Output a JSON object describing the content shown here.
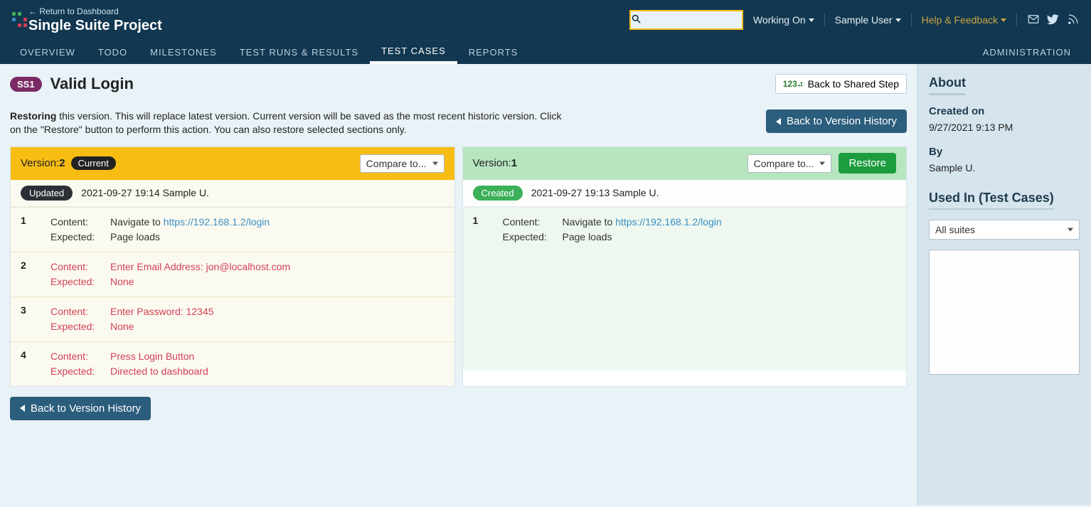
{
  "header": {
    "return_link": "← Return to Dashboard",
    "project": "Single Suite Project",
    "working_on": "Working On",
    "user": "Sample User",
    "help": "Help & Feedback"
  },
  "tabs": {
    "overview": "OVERVIEW",
    "todo": "TODO",
    "milestones": "MILESTONES",
    "testruns": "TEST RUNS & RESULTS",
    "testcases": "TEST CASES",
    "reports": "REPORTS",
    "admin": "ADMINISTRATION"
  },
  "case": {
    "chip": "SS1",
    "title": "Valid Login",
    "back_shared": "Back to Shared Step",
    "shared_icon_label": "123"
  },
  "restore": {
    "bold": "Restoring",
    "text": " this version. This will replace latest version. Current version will be saved as the most recent historic version. Click on the \"Restore\" button to perform this action. You can also restore selected sections only.",
    "back_history": "Back to Version History"
  },
  "v2": {
    "version_prefix": "Version:",
    "version_num": "2",
    "current": "Current",
    "compare": "Compare to...",
    "pill": "Updated",
    "meta": "2021-09-27 19:14 Sample U.",
    "steps": [
      {
        "num": "1",
        "added": false,
        "content_label": "Content:",
        "content_text": "Navigate to ",
        "content_link": "https://192.168.1.2/login",
        "expected_label": "Expected:",
        "expected_text": "Page loads"
      },
      {
        "num": "2",
        "added": true,
        "content_label": "Content:",
        "content_text": "Enter Email Address: jon@localhost.com",
        "content_link": "",
        "expected_label": "Expected:",
        "expected_text": "None"
      },
      {
        "num": "3",
        "added": true,
        "content_label": "Content:",
        "content_text": "Enter Password: 12345",
        "content_link": "",
        "expected_label": "Expected:",
        "expected_text": "None"
      },
      {
        "num": "4",
        "added": true,
        "content_label": "Content:",
        "content_text": "Press Login Button",
        "content_link": "",
        "expected_label": "Expected:",
        "expected_text": "Directed to dashboard"
      }
    ]
  },
  "v1": {
    "version_prefix": "Version:",
    "version_num": "1",
    "compare": "Compare to...",
    "restore_btn": "Restore",
    "pill": "Created",
    "meta": "2021-09-27 19:13 Sample U.",
    "steps": [
      {
        "num": "1",
        "added": false,
        "content_label": "Content:",
        "content_text": "Navigate to ",
        "content_link": "https://192.168.1.2/login",
        "expected_label": "Expected:",
        "expected_text": "Page loads"
      }
    ]
  },
  "sidebar": {
    "about": "About",
    "created_on_label": "Created on",
    "created_on_value": "9/27/2021 9:13 PM",
    "by_label": "By",
    "by_value": "Sample U.",
    "used_in": "Used In (Test Cases)",
    "suites_select": "All suites"
  }
}
